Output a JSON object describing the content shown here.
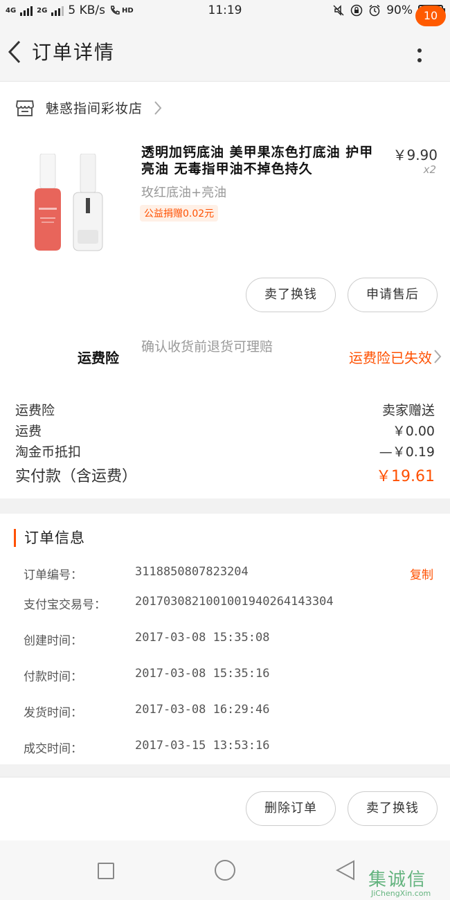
{
  "status_bar": {
    "network_1": "4G",
    "network_2": "2G",
    "speed": "5 KB/s",
    "hd": "HD",
    "time": "11:19",
    "battery_text": "90%",
    "battery_level": 0.9
  },
  "nav": {
    "title": "订单详情",
    "badge": "10"
  },
  "shop": {
    "name": "魅惑指间彩妆店"
  },
  "product": {
    "title": "透明加钙底油 美甲果冻色打底油 护甲亮油 无毒指甲油不掉色持久",
    "price": "￥9.90",
    "qty": "x2",
    "sku": "玫红底油+亮油",
    "charity": "公益捐赠0.02元"
  },
  "actions": {
    "sell_button": "卖了换钱",
    "after_sale_button": "申请售后"
  },
  "insurance": {
    "label": "运费险",
    "desc": "确认收货前退货可理赔",
    "status": "运费险已失效"
  },
  "fees": [
    {
      "label": "运费险",
      "value": "卖家赠送"
    },
    {
      "label": "运费",
      "value": "￥0.00"
    },
    {
      "label": "淘金币抵扣",
      "value": "—￥0.19"
    }
  ],
  "total": {
    "label": "实付款（含运费）",
    "value": "￥19.61"
  },
  "order_info": {
    "title": "订单信息",
    "copy_label": "复制",
    "rows": [
      {
        "k": "订单编号：",
        "v": "3118850807823204"
      },
      {
        "k": "支付宝交易号：",
        "v": "2017030821001001940264143304"
      },
      {
        "k": "创建时间：",
        "v": "2017-03-08 15:35:08"
      },
      {
        "k": "付款时间：",
        "v": "2017-03-08 15:35:16"
      },
      {
        "k": "发货时间：",
        "v": "2017-03-08 16:29:46"
      },
      {
        "k": "成交时间：",
        "v": "2017-03-15 13:53:16"
      }
    ]
  },
  "bottom": {
    "delete_button": "删除订单",
    "sell_button": "卖了换钱"
  },
  "watermark": {
    "cn": "集诚信",
    "en": "JiChengXin.com"
  },
  "colors": {
    "accent": "#ff5000",
    "badge": "#ff5a00"
  }
}
